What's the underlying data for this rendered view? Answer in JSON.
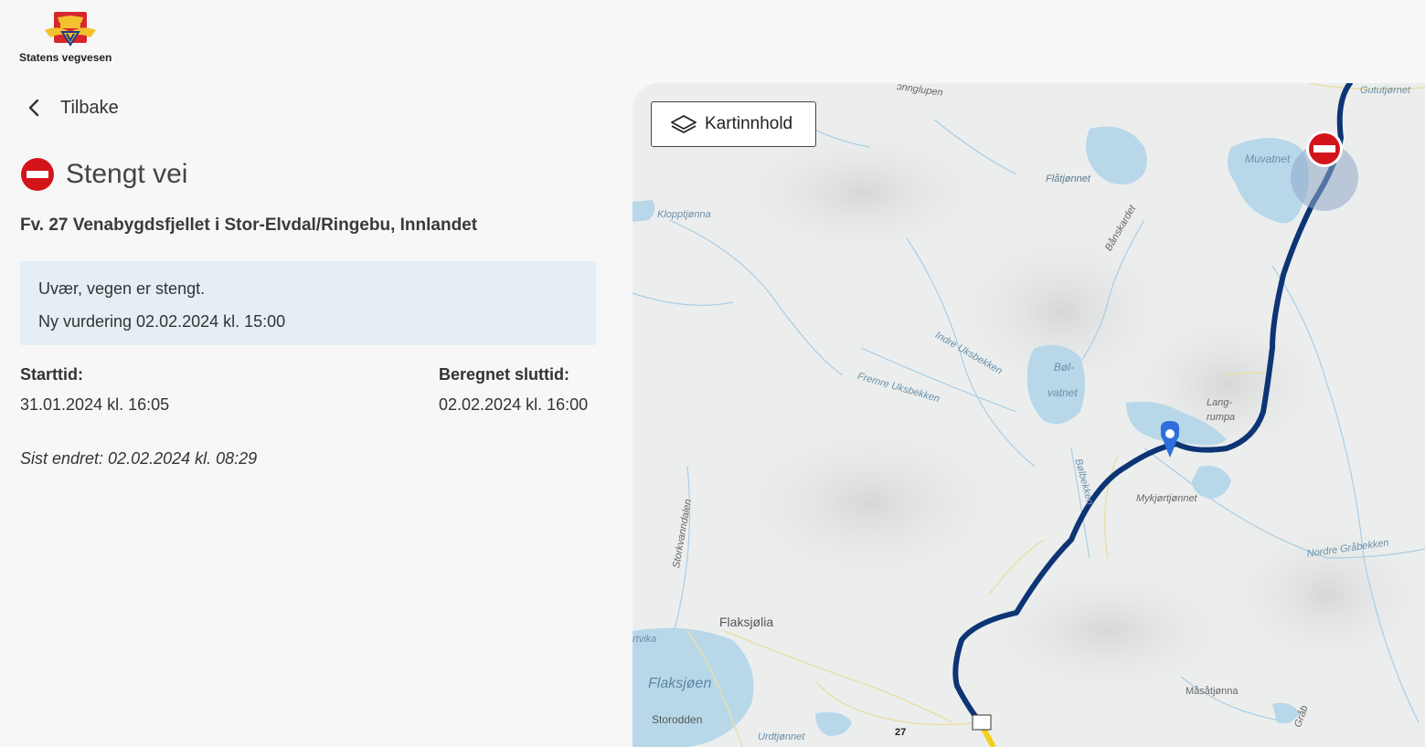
{
  "logo": {
    "text": "Statens vegvesen"
  },
  "nav": {
    "back_label": "Tilbake"
  },
  "status": {
    "title": "Stengt vei",
    "icon": "no-entry-icon",
    "color": "#d3151b"
  },
  "road": {
    "name": "Fv. 27 Venabygdsfjellet i Stor-Elvdal/Ringebu, Innlandet"
  },
  "message": {
    "line1": "Uvær, vegen er stengt.",
    "line2": "Ny vurdering 02.02.2024 kl. 15:00"
  },
  "start": {
    "label": "Starttid:",
    "value": "31.01.2024 kl. 16:05"
  },
  "end": {
    "label": "Beregnet sluttid:",
    "value": "02.02.2024 kl. 16:00"
  },
  "changed": {
    "text": "Sist endret: 02.02.2024 kl. 08:29"
  },
  "map": {
    "layers_button": "Kartinnhold",
    "route_color": "#0d3575",
    "water_color": "#b8d8ea",
    "route_number": "27",
    "places": {
      "gutut": "Gututjørnet",
      "muvatnet": "Muvatnet",
      "flatjonnet": "Flåtjønnet",
      "klopp": "Klopptjønna",
      "bans": "Bånskardet",
      "indre": "Indre Uksbekken",
      "fremre": "Fremre Uksbekken",
      "bol1": "Bøl-",
      "bol2": "vatnet",
      "lang1": "Lang-",
      "lang2": "rumpa",
      "bolbekken": "Bølbekken",
      "mykjor": "Mykjørtjønnet",
      "nordre": "Nordre Gråbekken",
      "stork": "Storkvanndalen",
      "flaksjolia": "Flaksjølia",
      "rtvika": "rtvika",
      "flaksjoen": "Flaksjøen",
      "storodden": "Storodden",
      "urdtjonnet": "Urdtjønnet",
      "masat": "Måsåtjønna",
      "grab": "Gråb",
      "gnglupen": "ɔnnglupen"
    }
  }
}
